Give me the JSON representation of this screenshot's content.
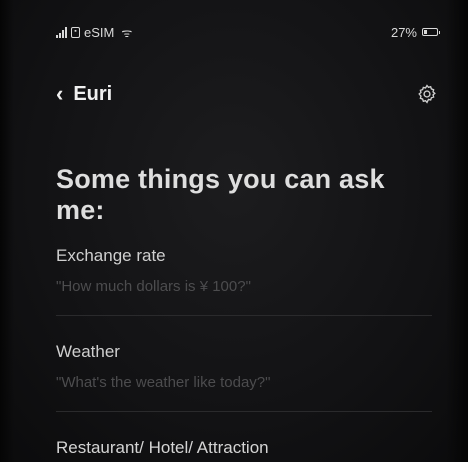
{
  "status_bar": {
    "carrier": "eSIM",
    "battery": "27%",
    "battery_level": 0.27
  },
  "header": {
    "title": "Euri",
    "back_icon": "chevron-left-icon",
    "settings_icon": "gear-icon"
  },
  "main": {
    "heading": "Some things you can ask me:",
    "items": [
      {
        "title": "Exchange rate",
        "example": "\"How much dollars is ¥ 100?\""
      },
      {
        "title": "Weather",
        "example": "\"What's the weather like today?\""
      },
      {
        "title": "Restaurant/ Hotel/ Attraction"
      }
    ]
  },
  "colors": {
    "background": "#121214",
    "text": "#dedede",
    "muted": "#4c4c4e"
  }
}
